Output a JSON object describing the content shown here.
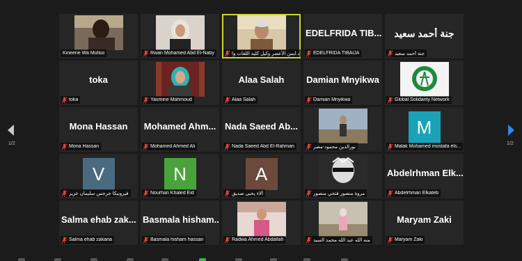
{
  "meeting": {
    "page_indicator_left": "1/2",
    "page_indicator_right": "1/2",
    "active_color": "#c8d833",
    "mic_muted_color": "#e04545"
  },
  "tiles": [
    {
      "display": "video",
      "video_scene": "person-dark",
      "label": "Kineene Wa Mutiso",
      "muted": false
    },
    {
      "display": "video",
      "video_scene": "person-hijab-light",
      "label": "Rwan Mohamed Abd El-Naby",
      "muted": true
    },
    {
      "display": "video",
      "video_scene": "person-older-office",
      "label": "د.ايمن الأعصر وكيل كلية اللغات وا",
      "muted": true,
      "active": true
    },
    {
      "display": "name",
      "big": "EDELFRIDA TIB...",
      "label": "EDELFRIDA TIBAIJA",
      "muted": true
    },
    {
      "display": "name",
      "big": "جنة أحمد سعيد",
      "arabic": true,
      "label": "جنة أحمد سعيد",
      "muted": true
    },
    {
      "display": "name",
      "big": "toka",
      "label": "toka",
      "muted": true
    },
    {
      "display": "video",
      "video_scene": "person-hijab-teal",
      "label": "Yasmine Mahmoud",
      "muted": true
    },
    {
      "display": "name",
      "big": "Alaa Salah",
      "label": "Alaa Salah",
      "muted": true
    },
    {
      "display": "name",
      "big": "Damian Mnyikwa",
      "label": "Damian Mnyikwa",
      "muted": true
    },
    {
      "display": "video",
      "video_scene": "logo-green",
      "label": "Global Solidarity Network",
      "muted": true
    },
    {
      "display": "name",
      "big": "Mona Hassan",
      "label": "Mona Hassan",
      "muted": true
    },
    {
      "display": "name",
      "big": "Mohamed  Ahm...",
      "label": "Mohamed Ahmed Ali",
      "muted": true
    },
    {
      "display": "name",
      "big": "Nada Saeed Ab...",
      "label": "Nada Saeed Abd El-Rahman",
      "muted": true
    },
    {
      "display": "video",
      "video_scene": "person-outdoor",
      "label": "نورالدين محمود-مصر",
      "muted": true
    },
    {
      "display": "avatar",
      "letter": "M",
      "avatar_color": "#1aa3b8",
      "label": "Malak Mohamed mostafa els...",
      "muted": true
    },
    {
      "display": "avatar",
      "letter": "V",
      "avatar_color": "#4a6a80",
      "label": "فيرونيكا جرجس سليمان عزيز",
      "muted": true
    },
    {
      "display": "avatar",
      "letter": "N",
      "avatar_color": "#4aa23c",
      "label": "Nourhan Khaled Eid",
      "muted": true
    },
    {
      "display": "avatar",
      "letter": "A",
      "avatar_color": "#6b4a3c",
      "label": "آلاء يحيى صديق",
      "muted": true
    },
    {
      "display": "video",
      "video_scene": "anime-profile",
      "label": "مروة منصور فتحي منصور",
      "muted": true
    },
    {
      "display": "name",
      "big": "Abdelrhman  Elk...",
      "label": "Abdelrhman Elkateb",
      "muted": true
    },
    {
      "display": "name",
      "big": "Salma ehab zak...",
      "label": "Salma ehab zakaria",
      "muted": true
    },
    {
      "display": "name",
      "big": "Basmala  hisham...",
      "label": "Basmala hisham hassan",
      "muted": true
    },
    {
      "display": "video",
      "video_scene": "person-pink",
      "label": "Radwa Ahmed Abdallah",
      "muted": true
    },
    {
      "display": "video",
      "video_scene": "person-outdoor-2",
      "label": "منه الله عبد الله محمد السيد",
      "muted": true
    },
    {
      "display": "name",
      "big": "Maryam Zaki",
      "label": "Maryam Zaki",
      "muted": true
    }
  ]
}
